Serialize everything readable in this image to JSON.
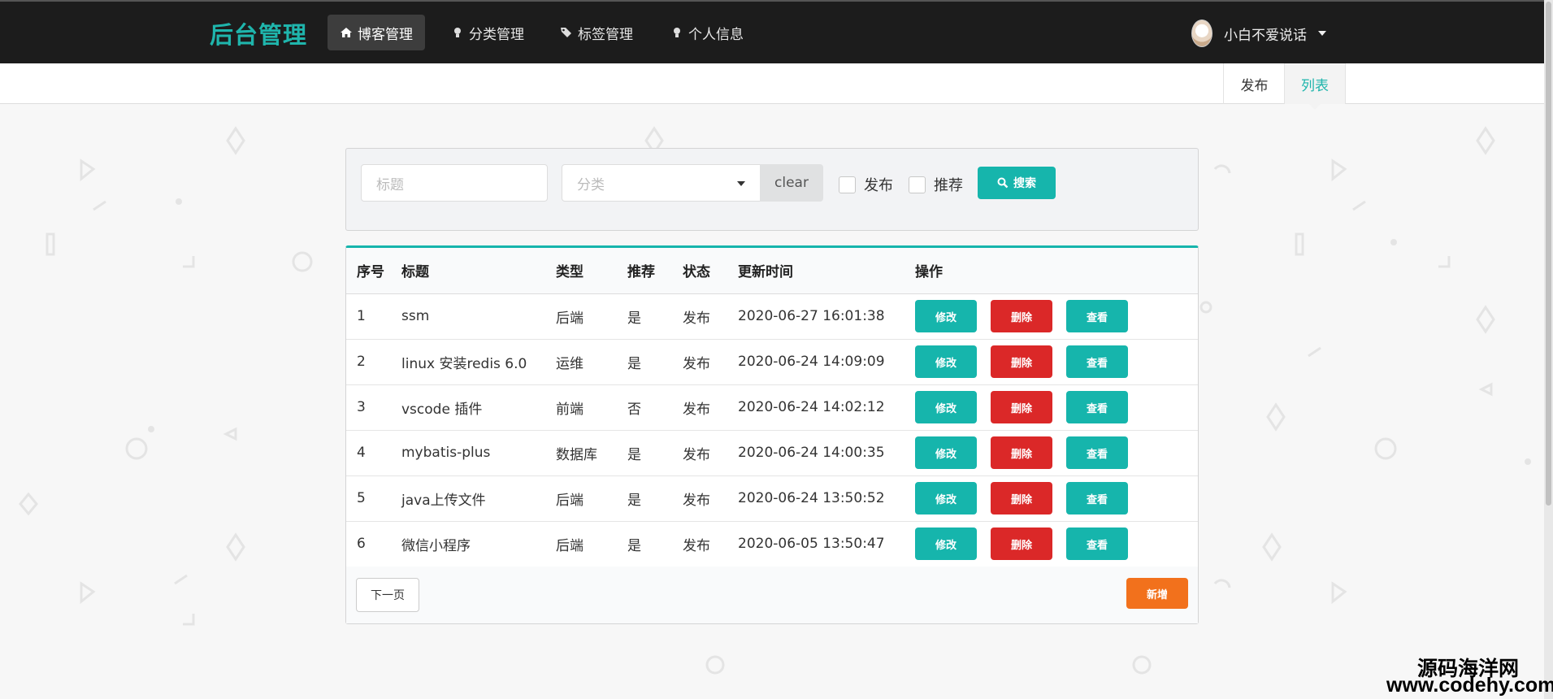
{
  "brand": "后台管理",
  "nav": {
    "items": [
      {
        "label": "博客管理",
        "icon": "home-icon",
        "active": true
      },
      {
        "label": "分类管理",
        "icon": "lightbulb-icon",
        "active": false
      },
      {
        "label": "标签管理",
        "icon": "tags-icon",
        "active": false
      },
      {
        "label": "个人信息",
        "icon": "lightbulb-icon",
        "active": false
      }
    ],
    "user_name": "小白不爱说话"
  },
  "subtabs": {
    "publish": "发布",
    "list": "列表"
  },
  "search": {
    "title_placeholder": "标题",
    "category_placeholder": "分类",
    "clear_label": "clear",
    "publish_label": "发布",
    "recommend_label": "推荐",
    "search_label": "搜索"
  },
  "table": {
    "headers": [
      "序号",
      "标题",
      "类型",
      "推荐",
      "状态",
      "更新时间",
      "操作"
    ],
    "rows": [
      {
        "idx": "1",
        "title": "ssm",
        "type": "后端",
        "rec": "是",
        "state": "发布",
        "time": "2020-06-27 16:01:38"
      },
      {
        "idx": "2",
        "title": "linux 安装redis 6.0",
        "type": "运维",
        "rec": "是",
        "state": "发布",
        "time": "2020-06-24 14:09:09"
      },
      {
        "idx": "3",
        "title": "vscode 插件",
        "type": "前端",
        "rec": "否",
        "state": "发布",
        "time": "2020-06-24 14:02:12"
      },
      {
        "idx": "4",
        "title": "mybatis-plus",
        "type": "数据库",
        "rec": "是",
        "state": "发布",
        "time": "2020-06-24 14:00:35"
      },
      {
        "idx": "5",
        "title": "java上传文件",
        "type": "后端",
        "rec": "是",
        "state": "发布",
        "time": "2020-06-24 13:50:52"
      },
      {
        "idx": "6",
        "title": "微信小程序",
        "type": "后端",
        "rec": "是",
        "state": "发布",
        "time": "2020-06-05 13:50:47"
      }
    ],
    "edit_label": "修改",
    "delete_label": "删除",
    "view_label": "查看",
    "next_label": "下一页",
    "add_label": "新增"
  },
  "watermark": {
    "line1": "源码海洋网",
    "line2": "www.codehy.com"
  },
  "colors": {
    "teal": "#16b5ac",
    "red": "#db2828",
    "orange": "#f2711c",
    "navbar": "#1c1c1c"
  }
}
